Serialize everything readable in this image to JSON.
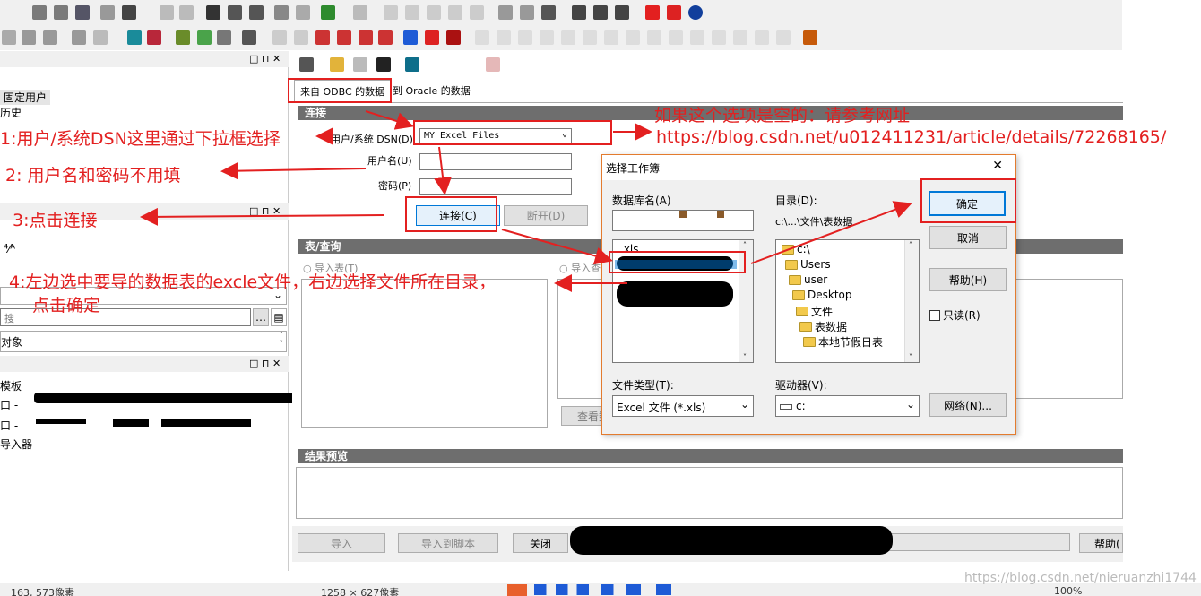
{
  "toolbar_rows": [
    "row1",
    "row2"
  ],
  "left_panel": {
    "items_top": [
      "固定用户",
      "历史"
    ],
    "row_icons": "⁴⁄ᴬ",
    "filter_placeholder": "搜",
    "object_label": "对象",
    "templates_label": "模板",
    "template_rows": [
      "口 -",
      "口 -"
    ],
    "importer_label": "导入器"
  },
  "import_tabs": {
    "odbc": "来自 ODBC 的数据",
    "oracle": "到 Oracle 的数据"
  },
  "connection": {
    "section": "连接",
    "dsn_label": "用户/系统 DSN(D)",
    "dsn_value": "MY Excel Files",
    "user_label": "用户名(U)",
    "password_label": "密码(P)",
    "connect_button": "连接(C)",
    "disconnect_button": "断开(D)"
  },
  "table_query": {
    "section": "表/查询",
    "import_table": "导入表(T)",
    "import_query": "导入查",
    "view_button": "查看数"
  },
  "result_preview": {
    "section": "结果预览"
  },
  "bottom_buttons": {
    "import": "导入",
    "import_to_script": "导入到脚本",
    "close": "关闭",
    "help": "帮助("
  },
  "dialog": {
    "title": "选择工作簿",
    "close_glyph": "✕",
    "db_name_label": "数据库名(A)",
    "db_list_first": ".xls",
    "dir_label": "目录(D):",
    "dir_path": "c:\\...\\文件\\表数据",
    "tree": [
      "c:\\",
      "Users",
      "user",
      "Desktop",
      "文件",
      "表数据",
      "本地节假日表"
    ],
    "ok_button": "确定",
    "cancel_button": "取消",
    "help_button": "帮助(H)",
    "readonly_label": "只读(R)",
    "file_type_label": "文件类型(T):",
    "file_type_value": "Excel 文件 (*.xls)",
    "drive_label": "驱动器(V):",
    "drive_value": "c:",
    "network_button": "网络(N)..."
  },
  "annotations": {
    "a1": "1:用户/系统DSN这里通过下拉框选择",
    "a2": "2:  用户名和密码不用填",
    "a3": "3:点击连接",
    "a4_line1": "4:左边选中要导的数据表的excle文件，右边选择文件所在目录，",
    "a4_line2": "点击确定",
    "a5_line1": "如果这个选项是空的：请参考网址",
    "a5_line2": "https://blog.csdn.net/u012411231/article/details/72268165/"
  },
  "status_bar": {
    "s1": "163, 573像素",
    "s2": "1258 × 627像素",
    "s3": "100%",
    "watermark": "https://blog.csdn.net/nieruanzhi1744"
  },
  "colors": {
    "annotation_red": "#e32020",
    "section_gray": "#6e6e6e",
    "accent_blue": "#0078d7"
  }
}
